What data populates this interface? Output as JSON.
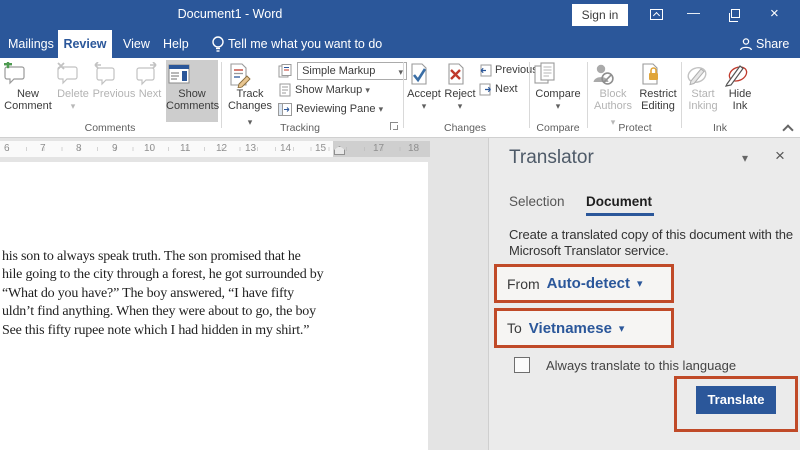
{
  "colors": {
    "title_bar_blue": "#2b579a",
    "accent_blue": "#2b579a",
    "highlight_orange": "#c04a28",
    "translate_button_blue": "#2b579a",
    "reject_red": "#c0392b",
    "accept_check_blue": "#3a6ea5",
    "lock_gold": "#e0a53a",
    "new_comment_green": "#4e9a51"
  },
  "icons": {
    "caret_down": "▾",
    "close_x": "×",
    "minimize": "—"
  },
  "title_bar": {
    "title": "Document1 - Word",
    "sign_in_label": "Sign in"
  },
  "tab_row": {
    "tabs": [
      "Mailings",
      "Review",
      "View",
      "Help"
    ],
    "active_tab": "Review",
    "tell_me": "Tell me what you want to do",
    "share_label": "Share"
  },
  "ribbon": {
    "comments": {
      "group_label": "Comments",
      "new_comment": "New Comment",
      "delete": "Delete",
      "previous": "Previous",
      "next": "Next",
      "show_comments": "Show Comments"
    },
    "tracking": {
      "group_label": "Tracking",
      "track_changes": "Track Changes",
      "simple_markup": "Simple Markup",
      "show_markup": "Show Markup",
      "reviewing_pane": "Reviewing Pane"
    },
    "changes": {
      "group_label": "Changes",
      "accept": "Accept",
      "reject": "Reject",
      "previous": "Previous",
      "next": "Next"
    },
    "compare": {
      "group_label": "Compare",
      "compare": "Compare"
    },
    "protect": {
      "group_label": "Protect",
      "block_authors": "Block Authors",
      "restrict_editing": "Restrict Editing"
    },
    "ink": {
      "group_label": "Ink",
      "start_inking": "Start Inking",
      "hide_ink": "Hide Ink"
    }
  },
  "ruler": {
    "numbers": [
      "6",
      "7",
      "8",
      "9",
      "10",
      "11",
      "12",
      "13",
      "14",
      "15",
      "17",
      "18"
    ]
  },
  "document": {
    "lines": [
      "his son to always speak truth. The son promised that he",
      "hile going to the city through a forest, he got surrounded by",
      "“What do you have?” The boy answered, “I have fifty",
      "uldn’t find anything. When they were about to go, the boy",
      "See this fifty rupee note which I had hidden in my shirt.”"
    ]
  },
  "translator": {
    "title": "Translator",
    "tabs": {
      "selection": "Selection",
      "document": "Document"
    },
    "description": "Create a translated copy of this document with the Microsoft Translator service.",
    "from_label": "From",
    "from_value": "Auto-detect",
    "to_label": "To",
    "to_value": "Vietnamese",
    "always_translate_label": "Always translate to this language",
    "translate_button": "Translate"
  }
}
